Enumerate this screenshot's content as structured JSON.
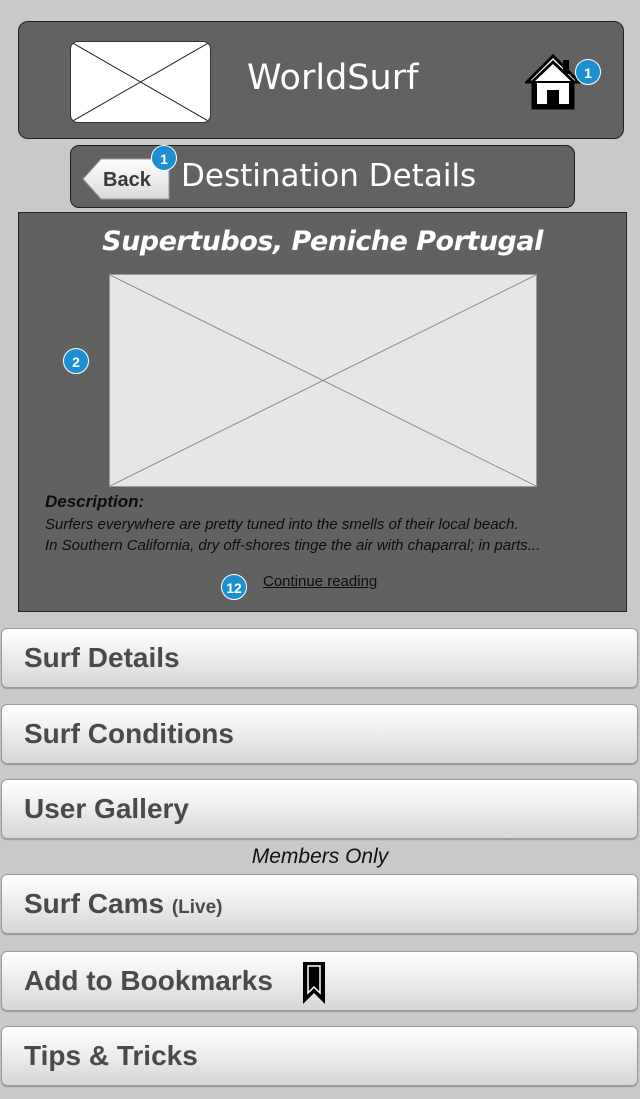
{
  "header": {
    "app_title": "WorldSurf",
    "logo_icon": "image-placeholder-icon",
    "home_icon": "home-icon",
    "home_badge": "1"
  },
  "subheader": {
    "back_label": "Back",
    "back_badge": "1",
    "title": "Destination Details"
  },
  "destination": {
    "name": "Supertubos, Peniche Portugal",
    "image_badge": "2",
    "description_label": "Description:",
    "description_lines": [
      "Surfers everywhere are pretty tuned into the smells of their local beach.",
      "In Southern California, dry off-shores tinge the air with chaparral; in parts..."
    ],
    "more_badge": "12",
    "continue_label": "Continue reading"
  },
  "menu": {
    "surf_details": "Surf Details",
    "surf_conditions": "Surf Conditions",
    "user_gallery": "User Gallery",
    "members_note": "Members Only",
    "surf_cams": "Surf Cams",
    "surf_cams_sub": "(Live)",
    "add_bookmarks": "Add to Bookmarks",
    "tips_tricks": "Tips & Tricks"
  },
  "colors": {
    "panel": "#626262",
    "background": "#c9c9c9",
    "badge": "#1c8fd0"
  }
}
